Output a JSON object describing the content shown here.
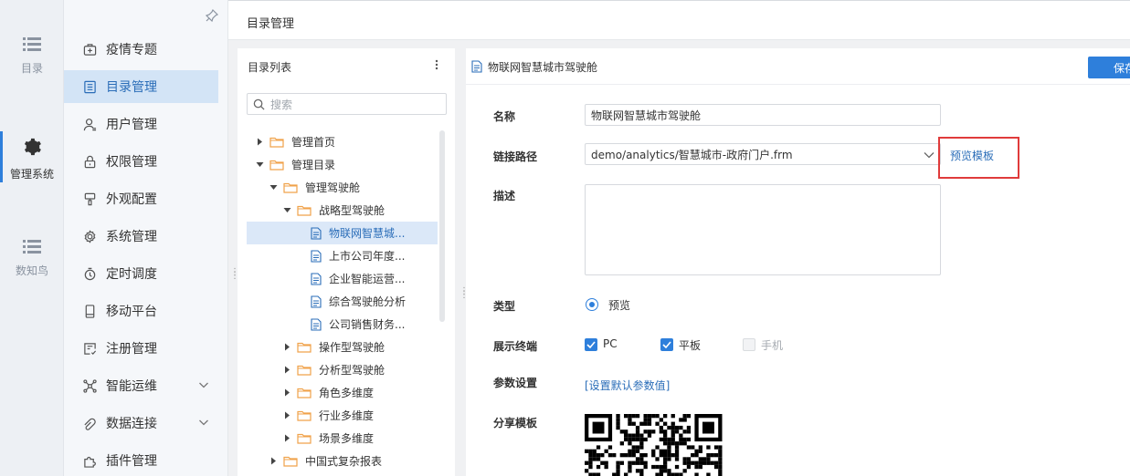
{
  "rail": {
    "items": [
      {
        "label": "目录",
        "icon": "list-icon"
      },
      {
        "label": "管理系统",
        "icon": "gear-icon"
      },
      {
        "label": "数知鸟",
        "icon": "list-icon"
      }
    ]
  },
  "menu": {
    "items": [
      {
        "label": "疫情专题",
        "icon": "medkit-icon"
      },
      {
        "label": "目录管理",
        "icon": "catalog-icon"
      },
      {
        "label": "用户管理",
        "icon": "user-icon"
      },
      {
        "label": "权限管理",
        "icon": "lock-icon"
      },
      {
        "label": "外观配置",
        "icon": "brush-icon"
      },
      {
        "label": "系统管理",
        "icon": "settings-icon"
      },
      {
        "label": "定时调度",
        "icon": "clock-icon"
      },
      {
        "label": "移动平台",
        "icon": "mobile-icon"
      },
      {
        "label": "注册管理",
        "icon": "register-icon"
      },
      {
        "label": "智能运维",
        "icon": "ops-icon"
      },
      {
        "label": "数据连接",
        "icon": "link-icon"
      },
      {
        "label": "插件管理",
        "icon": "plugin-icon"
      }
    ]
  },
  "header": {
    "title": "目录管理"
  },
  "tree": {
    "title": "目录列表",
    "search_placeholder": "搜索",
    "nodes": [
      {
        "label": "管理首页"
      },
      {
        "label": "管理目录"
      },
      {
        "label": "管理驾驶舱"
      },
      {
        "label": "战略型驾驶舱"
      },
      {
        "label": "物联网智慧城..."
      },
      {
        "label": "上市公司年度..."
      },
      {
        "label": "企业智能运营..."
      },
      {
        "label": "综合驾驶舱分析"
      },
      {
        "label": "公司销售财务..."
      },
      {
        "label": "操作型驾驶舱"
      },
      {
        "label": "分析型驾驶舱"
      },
      {
        "label": "角色多维度"
      },
      {
        "label": "行业多维度"
      },
      {
        "label": "场景多维度"
      },
      {
        "label": "中国式复杂报表"
      }
    ]
  },
  "detail": {
    "title": "物联网智慧城市驾驶舱",
    "save_label": "保存",
    "name_label": "名称",
    "name_value": "物联网智慧城市驾驶舱",
    "path_label": "链接路径",
    "path_value": "demo/analytics/智慧城市-政府门户.frm",
    "preview_template": "预览模板",
    "desc_label": "描述",
    "type_label": "类型",
    "type_option": "预览",
    "terminal_label": "展示终端",
    "terminals": [
      {
        "label": "PC",
        "checked": true
      },
      {
        "label": "平板",
        "checked": true
      },
      {
        "label": "手机",
        "checked": false
      }
    ],
    "param_label": "参数设置",
    "param_link": "[设置默认参数值]",
    "share_label": "分享模板"
  },
  "colors": {
    "accent": "#2e7fdb",
    "highlight": "#e03b3b",
    "folder": "#f0a24a"
  }
}
